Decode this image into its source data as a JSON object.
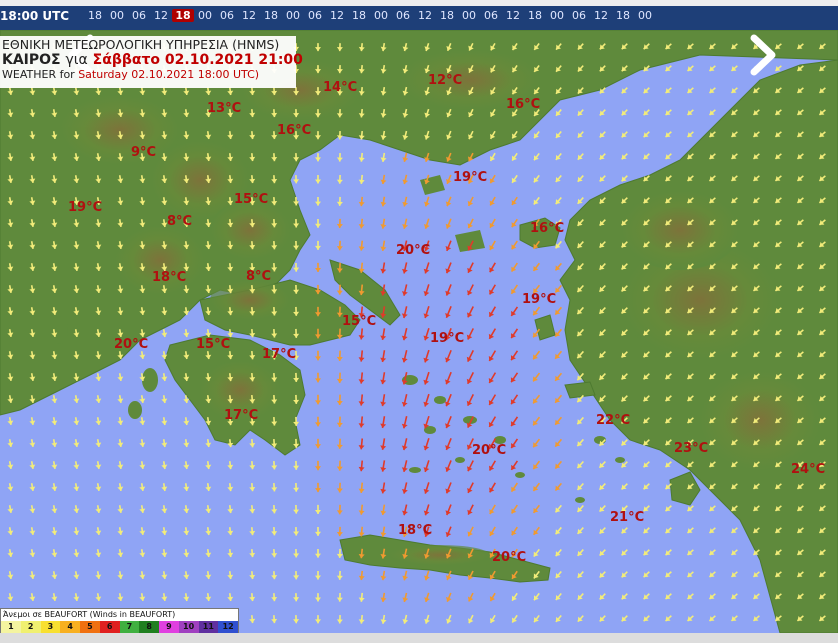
{
  "topbar": {
    "utc_label": "18:00 UTC",
    "hours": [
      "18",
      "00",
      "06",
      "12",
      "18",
      "00",
      "06",
      "12",
      "18",
      "00",
      "06",
      "12",
      "18",
      "00",
      "06",
      "12",
      "18",
      "00",
      "06",
      "12",
      "18",
      "00",
      "06",
      "12",
      "18",
      "00"
    ],
    "selected_index": 4
  },
  "title": {
    "line1": "ΕΘΝΙΚΗ ΜΕΤΕΩΡΟΛΟΓΙΚΗ ΥΠΗΡΕΣΙΑ (HNMS)",
    "line2_prefix": "ΚΑΙΡΟΣ",
    "line2_word": "για",
    "line2_date": "Σάββατο 02.10.2021 21:00",
    "line3_prefix": "WEATHER for",
    "line3_date": "Saturday 02.10.2021 18:00 UTC)"
  },
  "temperatures": [
    {
      "label": "14°C"
    },
    {
      "label": "12°C"
    },
    {
      "label": "16°C"
    },
    {
      "label": "13°C"
    },
    {
      "label": "16°C"
    },
    {
      "label": "9°C"
    },
    {
      "label": "19°C"
    },
    {
      "label": "15°C"
    },
    {
      "label": "19°C"
    },
    {
      "label": "8°C"
    },
    {
      "label": "16°C"
    },
    {
      "label": "20°C"
    },
    {
      "label": "18°C"
    },
    {
      "label": "8°C"
    },
    {
      "label": "19°C"
    },
    {
      "label": "15°C"
    },
    {
      "label": "20°C"
    },
    {
      "label": "15°C"
    },
    {
      "label": "19°C"
    },
    {
      "label": "17°C"
    },
    {
      "label": "17°C"
    },
    {
      "label": "22°C"
    },
    {
      "label": "20°C"
    },
    {
      "label": "23°C"
    },
    {
      "label": "24°C"
    },
    {
      "label": "21°C"
    },
    {
      "label": "18°C"
    },
    {
      "label": "20°C"
    }
  ],
  "legend": {
    "title": "Άνεμοι σε BEAUFORT   (Winds in BEAUFORT)",
    "scale": [
      {
        "label": "1",
        "color": "#f4f4a0"
      },
      {
        "label": "2",
        "color": "#f0f070"
      },
      {
        "label": "3",
        "color": "#f8e030"
      },
      {
        "label": "4",
        "color": "#f8b020"
      },
      {
        "label": "5",
        "color": "#f07010"
      },
      {
        "label": "6",
        "color": "#e02020"
      },
      {
        "label": "7",
        "color": "#40b040"
      },
      {
        "label": "8",
        "color": "#208020"
      },
      {
        "label": "9",
        "color": "#e040e0"
      },
      {
        "label": "10",
        "color": "#a040c0"
      },
      {
        "label": "11",
        "color": "#6030a0"
      },
      {
        "label": "12",
        "color": "#3050d0"
      }
    ]
  },
  "colors": {
    "sea": "#8fa4f5",
    "land": "#5f8a3c",
    "wind_light": "#f2ec7a",
    "wind_mid": "#f09a30",
    "wind_strong": "#e03a2a",
    "temp": "#b01010"
  }
}
